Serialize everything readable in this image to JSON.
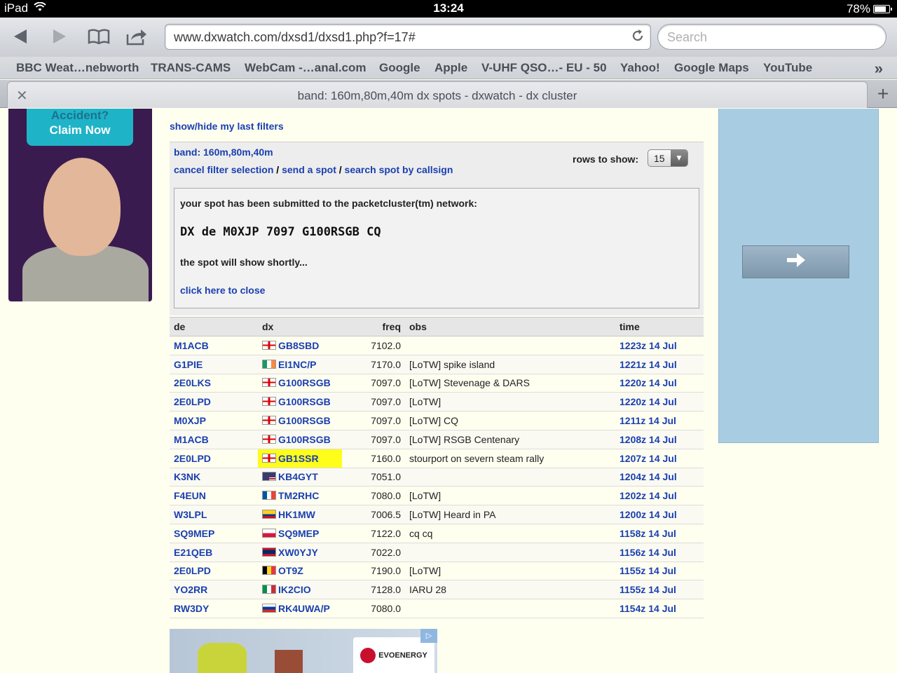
{
  "status_bar": {
    "device": "iPad",
    "time": "13:24",
    "battery": "78%",
    "battery_level": 0.78
  },
  "toolbar": {
    "url": "www.dxwatch.com/dxsd1/dxsd1.php?f=17#",
    "search_placeholder": "Search"
  },
  "bookmarks": [
    "BBC Weat…nebworth",
    "TRANS-CAMS",
    "WebCam -…anal.com",
    "Google",
    "Apple",
    "V-UHF QSO…- EU - 50",
    "Yahoo!",
    "Google Maps",
    "YouTube"
  ],
  "tab": {
    "title": "band: 160m,80m,40m dx spots - dxwatch - dx cluster"
  },
  "ad_left": {
    "line1": "Accident?",
    "line2": "Claim Now"
  },
  "ad_bottom": {
    "logo_text": "EVOENERGY"
  },
  "page": {
    "filters_link": "show/hide my last filters",
    "band": "band: 160m,80m,40m",
    "cancel_link": "cancel filter selection",
    "send_link": "send a spot",
    "search_link": "search spot by callsign",
    "separator": " / ",
    "rows_label": "rows to show:",
    "rows_value": "15",
    "notice": {
      "title": "your spot has been submitted to the packetcluster(tm) network:",
      "spot": "DX de M0XJP 7097 G100RSGB CQ",
      "shortly": "the spot will show shortly...",
      "close": "click here to close"
    }
  },
  "table": {
    "headers": [
      "de",
      "dx",
      "freq",
      "obs",
      "time"
    ],
    "rows": [
      {
        "de": "M1ACB",
        "flag": "england",
        "dx": "GB8SBD",
        "freq": "7102.0",
        "obs": "",
        "time": "1223z 14 Jul"
      },
      {
        "de": "G1PIE",
        "flag": "ireland",
        "dx": "EI1NC/P",
        "freq": "7170.0",
        "obs": "[LoTW] spike island",
        "time": "1221z 14 Jul"
      },
      {
        "de": "2E0LKS",
        "flag": "england",
        "dx": "G100RSGB",
        "freq": "7097.0",
        "obs": "[LoTW] Stevenage & DARS",
        "time": "1220z 14 Jul"
      },
      {
        "de": "2E0LPD",
        "flag": "england",
        "dx": "G100RSGB",
        "freq": "7097.0",
        "obs": "[LoTW]",
        "time": "1220z 14 Jul"
      },
      {
        "de": "M0XJP",
        "flag": "england",
        "dx": "G100RSGB",
        "freq": "7097.0",
        "obs": "[LoTW] CQ",
        "time": "1211z 14 Jul"
      },
      {
        "de": "M1ACB",
        "flag": "england",
        "dx": "G100RSGB",
        "freq": "7097.0",
        "obs": "[LoTW] RSGB Centenary",
        "time": "1208z 14 Jul"
      },
      {
        "de": "2E0LPD",
        "flag": "england",
        "dx": "GB1SSR",
        "freq": "7160.0",
        "obs": "stourport on severn steam rally",
        "time": "1207z 14 Jul",
        "highlight": true
      },
      {
        "de": "K3NK",
        "flag": "usa",
        "dx": "KB4GYT",
        "freq": "7051.0",
        "obs": "",
        "time": "1204z 14 Jul"
      },
      {
        "de": "F4EUN",
        "flag": "france",
        "dx": "TM2RHC",
        "freq": "7080.0",
        "obs": "[LoTW]",
        "time": "1202z 14 Jul"
      },
      {
        "de": "W3LPL",
        "flag": "colombia",
        "dx": "HK1MW",
        "freq": "7006.5",
        "obs": "[LoTW] Heard in PA",
        "time": "1200z 14 Jul"
      },
      {
        "de": "SQ9MEP",
        "flag": "poland",
        "dx": "SQ9MEP",
        "freq": "7122.0",
        "obs": "cq cq",
        "time": "1158z 14 Jul"
      },
      {
        "de": "E21QEB",
        "flag": "laos",
        "dx": "XW0YJY",
        "freq": "7022.0",
        "obs": "",
        "time": "1156z 14 Jul"
      },
      {
        "de": "2E0LPD",
        "flag": "belgium",
        "dx": "OT9Z",
        "freq": "7190.0",
        "obs": "[LoTW]",
        "time": "1155z 14 Jul"
      },
      {
        "de": "YO2RR",
        "flag": "italy",
        "dx": "IK2CIO",
        "freq": "7128.0",
        "obs": "IARU 28",
        "time": "1155z 14 Jul"
      },
      {
        "de": "RW3DY",
        "flag": "russia",
        "dx": "RK4UWA/P",
        "freq": "7080.0",
        "obs": "",
        "time": "1154z 14 Jul"
      }
    ]
  }
}
